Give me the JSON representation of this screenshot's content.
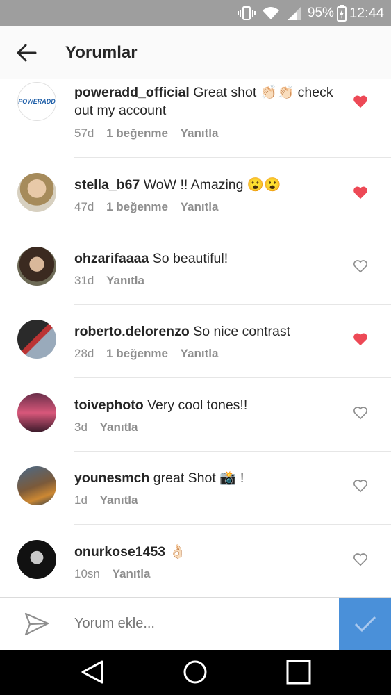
{
  "status": {
    "battery": "95%",
    "time": "12:44"
  },
  "header": {
    "title": "Yorumlar"
  },
  "comments": [
    {
      "user": "poweradd_official",
      "text": "Great shot 👏🏻👏🏻 check out my account",
      "time": "57d",
      "likes": "1 beğenme",
      "reply": "Yanıtla",
      "liked": true,
      "avatar_text": "POWERADD"
    },
    {
      "user": "stella_b67",
      "text": "WoW !! Amazing 😮😮",
      "time": "47d",
      "likes": "1 beğenme",
      "reply": "Yanıtla",
      "liked": true
    },
    {
      "user": "ohzarifaaaa",
      "text": "So beautiful!",
      "time": "31d",
      "likes": "",
      "reply": "Yanıtla",
      "liked": false
    },
    {
      "user": "roberto.delorenzo",
      "text": "So nice contrast",
      "time": "28d",
      "likes": "1 beğenme",
      "reply": "Yanıtla",
      "liked": true
    },
    {
      "user": "toivephoto",
      "text": "Very cool tones!!",
      "time": "3d",
      "likes": "",
      "reply": "Yanıtla",
      "liked": false
    },
    {
      "user": "younesmch",
      "text": "great Shot 📸 !",
      "time": "1d",
      "likes": "",
      "reply": "Yanıtla",
      "liked": false
    },
    {
      "user": "onurkose1453",
      "text": "👌🏻",
      "time": "10sn",
      "likes": "",
      "reply": "Yanıtla",
      "liked": false
    }
  ],
  "composer": {
    "placeholder": "Yorum ekle..."
  },
  "colors": {
    "like": "#ed4956",
    "post_button": "#4a90d9",
    "status_bar": "#9e9e9e"
  }
}
